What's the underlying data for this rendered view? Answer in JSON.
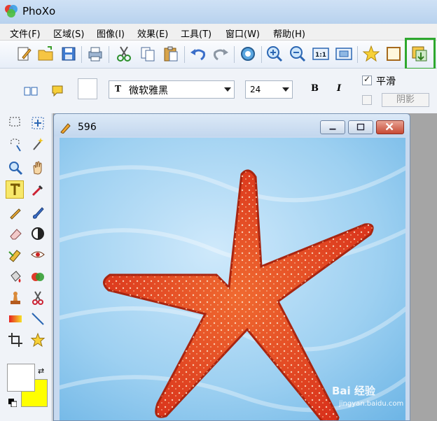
{
  "app": {
    "title": "PhoXo"
  },
  "menu": [
    "文件(F)",
    "区域(S)",
    "图像(I)",
    "效果(E)",
    "工具(T)",
    "窗口(W)",
    "帮助(H)"
  ],
  "toolbar": {
    "icons": [
      "new-icon",
      "open-icon",
      "save-icon",
      "print-icon",
      "cut-icon",
      "copy-icon",
      "paste-icon",
      "undo-icon",
      "redo-icon",
      "settings-icon",
      "zoom-in-icon",
      "zoom-out-icon",
      "actual-size-icon",
      "fit-window-icon",
      "favorite-star-icon",
      "frame-icon",
      "add-layer-icon"
    ],
    "actual_size_label": "1:1"
  },
  "text_options": {
    "font": "微软雅黑",
    "font_icon_label": "T",
    "size": "24",
    "bold_label": "B",
    "italic_label": "I",
    "smooth_label": "平滑",
    "smooth_checked": true,
    "shadow_label": "阴影",
    "shadow_checked": false
  },
  "colors": {
    "foreground": "#ffffff",
    "background": "#ffff00",
    "accent_highlight": "#2ea82e"
  },
  "document": {
    "title": "596"
  },
  "watermark": {
    "brand": "Bai 经验",
    "url": "jingyan.baidu.com"
  }
}
